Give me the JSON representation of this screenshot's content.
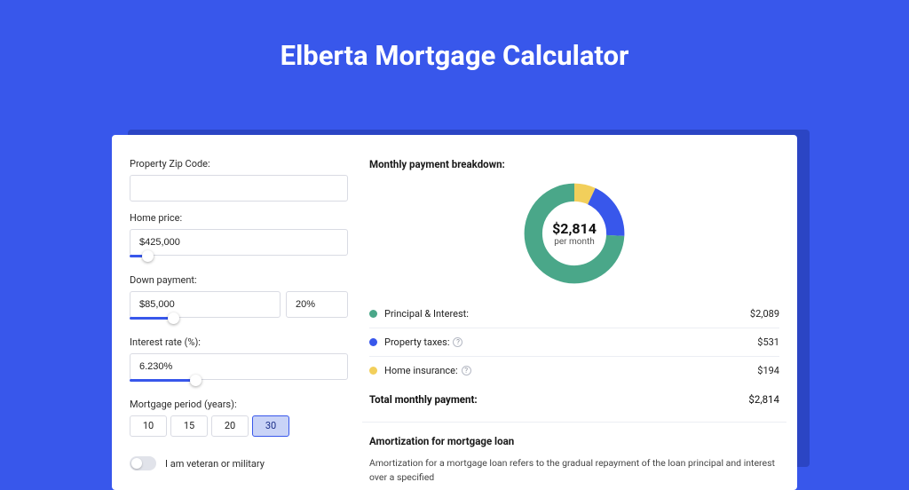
{
  "title": "Elberta Mortgage Calculator",
  "form": {
    "zip_label": "Property Zip Code:",
    "zip_value": "",
    "home_price_label": "Home price:",
    "home_price_value": "$425,000",
    "home_price_slider_pct": 8,
    "down_payment_label": "Down payment:",
    "down_payment_value": "$85,000",
    "down_payment_pct_value": "20%",
    "down_payment_slider_pct": 20,
    "rate_label": "Interest rate (%):",
    "rate_value": "6.230%",
    "rate_slider_pct": 30,
    "period_label": "Mortgage period (years):",
    "period_options": [
      "10",
      "15",
      "20",
      "30"
    ],
    "period_selected_index": 3,
    "veteran_label": "I am veteran or military"
  },
  "breakdown": {
    "title": "Monthly payment breakdown:",
    "center_amount": "$2,814",
    "center_sub": "per month",
    "rows": [
      {
        "label": "Principal & Interest:",
        "value": "$2,089",
        "pct": 74.2,
        "color": "#4aa789",
        "help": false
      },
      {
        "label": "Property taxes:",
        "value": "$531",
        "pct": 18.9,
        "color": "#3857eb",
        "help": true
      },
      {
        "label": "Home insurance:",
        "value": "$194",
        "pct": 6.9,
        "color": "#f2cf5b",
        "help": true
      }
    ],
    "total_label": "Total monthly payment:",
    "total_value": "$2,814"
  },
  "amortization": {
    "title": "Amortization for mortgage loan",
    "text": "Amortization for a mortgage loan refers to the gradual repayment of the loan principal and interest over a specified"
  },
  "chart_data": {
    "type": "pie",
    "title": "Monthly payment breakdown",
    "series": [
      {
        "name": "Principal & Interest",
        "value": 2089,
        "color": "#4aa789"
      },
      {
        "name": "Property taxes",
        "value": 531,
        "color": "#3857eb"
      },
      {
        "name": "Home insurance",
        "value": 194,
        "color": "#f2cf5b"
      }
    ],
    "total": 2814,
    "center_label": "$2,814 per month"
  }
}
